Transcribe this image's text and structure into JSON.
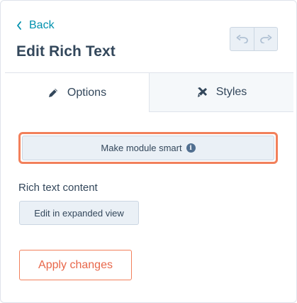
{
  "header": {
    "back_label": "Back",
    "title": "Edit Rich Text",
    "undo_icon": "undo-icon",
    "redo_icon": "redo-icon"
  },
  "tabs": [
    {
      "label": "Options",
      "icon": "pencil-icon",
      "active": true
    },
    {
      "label": "Styles",
      "icon": "brush-icon",
      "active": false
    }
  ],
  "smart_button": {
    "label": "Make module smart",
    "icon": "info-icon"
  },
  "rich_text": {
    "label": "Rich text content",
    "expand_label": "Edit in expanded view"
  },
  "apply_label": "Apply changes",
  "colors": {
    "link": "#0091ae",
    "text": "#33475b",
    "highlight": "#f2805b",
    "apply_text": "#e8674a",
    "button_bg": "#eaf0f6",
    "border": "#cbd6e2"
  }
}
